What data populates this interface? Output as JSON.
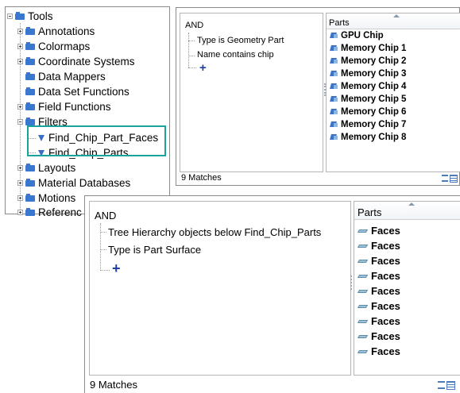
{
  "tree": {
    "root_label": "Tools",
    "items": [
      {
        "label": "Annotations"
      },
      {
        "label": "Colormaps"
      },
      {
        "label": "Coordinate Systems"
      },
      {
        "label": "Data Mappers"
      },
      {
        "label": "Data Set Functions"
      },
      {
        "label": "Field Functions"
      },
      {
        "label": "Filters"
      },
      {
        "label": "Find_Chip_Part_Faces"
      },
      {
        "label": "Find_Chip_Parts"
      },
      {
        "label": "Layouts"
      },
      {
        "label": "Material Databases"
      },
      {
        "label": "Motions"
      },
      {
        "label": "Referenc"
      }
    ]
  },
  "query_top": {
    "operator": "AND",
    "criteria": [
      "Type is Geometry Part",
      "Name contains chip"
    ],
    "add_symbol": "+",
    "parts_header": "Parts",
    "parts": [
      "GPU Chip",
      "Memory Chip 1",
      "Memory Chip 2",
      "Memory Chip 3",
      "Memory Chip 4",
      "Memory Chip 5",
      "Memory Chip 6",
      "Memory Chip 7",
      "Memory Chip 8"
    ],
    "matches": "9 Matches"
  },
  "query_bottom": {
    "operator": "AND",
    "criteria": [
      "Tree Hierarchy objects below Find_Chip_Parts",
      "Type is Part Surface"
    ],
    "add_symbol": "+",
    "parts_header": "Parts",
    "parts": [
      "Faces",
      "Faces",
      "Faces",
      "Faces",
      "Faces",
      "Faces",
      "Faces",
      "Faces",
      "Faces"
    ],
    "matches": "9 Matches"
  },
  "colors": {
    "highlight": "#1aa39d",
    "folder": "#3a78d0",
    "add": "#1e3f9e"
  }
}
